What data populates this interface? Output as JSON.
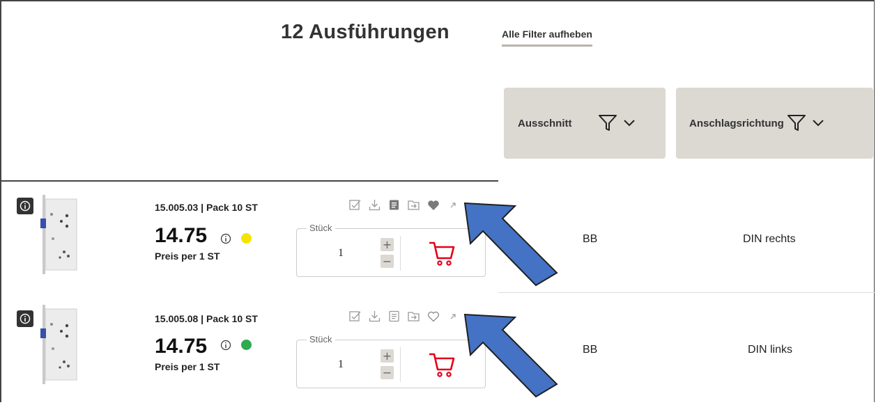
{
  "header": {
    "result_count_label": "12 Ausführungen",
    "clear_filters_label": "Alle Filter aufheben"
  },
  "filters": [
    {
      "label": "Ausschnitt",
      "icons": [
        "funnel-icon",
        "chevron-down-icon"
      ]
    },
    {
      "label": "Anschlagsrichtung",
      "icons": [
        "funnel-icon",
        "chevron-down-icon"
      ]
    }
  ],
  "rows": [
    {
      "sku_label": "15.005.03 | Pack 10 ST",
      "price": "14.75",
      "unit_label": "Preis per 1 ST",
      "stock_color": "#f5e400",
      "quantity_legend": "Stück",
      "quantity": "1",
      "favorite_filled": true,
      "ausschnitt": "BB",
      "anschlagsrichtung": "DIN rechts"
    },
    {
      "sku_label": "15.005.08 | Pack 10 ST",
      "price": "14.75",
      "unit_label": "Preis per 1 ST",
      "stock_color": "#2eaa4f",
      "quantity_legend": "Stück",
      "quantity": "1",
      "favorite_filled": false,
      "ausschnitt": "BB",
      "anschlagsrichtung": "DIN links"
    }
  ],
  "stepper": {
    "plus": "+",
    "minus": "−"
  },
  "colors": {
    "filter_bg": "#dcd8d2",
    "cart_red": "#e3001b",
    "annotation_arrow": "#4472c4",
    "annotation_arrow_border": "#1f1f1f"
  }
}
